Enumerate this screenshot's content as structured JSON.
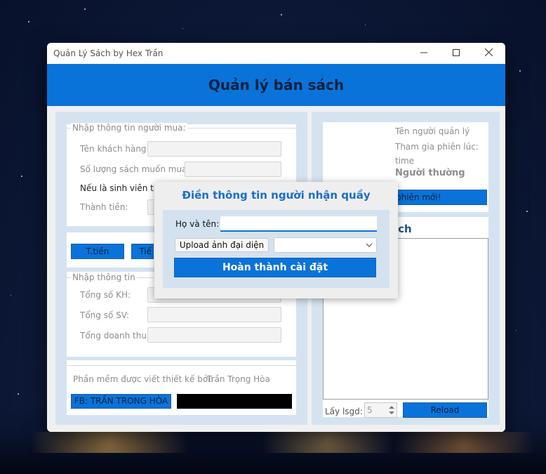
{
  "window": {
    "title": "Quản Lý Sách by Hex Trần"
  },
  "header": {
    "title": "Quản lý bán sách"
  },
  "buyer": {
    "legend": "Nhập thông tin người mua:",
    "customer_label": "Tên khách hàng:",
    "quantity_label": "Số lượng sách muốn mua:",
    "student_text": "Nếu là sinh viên thì",
    "total_label": "Thành tiền:"
  },
  "actions": {
    "calc_label": "T.tiền",
    "second_label": "Tiế"
  },
  "stats": {
    "legend": "Nhập thông tin",
    "customers_label": "Tổng số KH:",
    "students_label": "Tổng số SV:",
    "revenue_label": "Tổng doanh thu:"
  },
  "credit": {
    "text": "Phần mềm được viết  thiết kế bởi:",
    "author": "Trần Trọng Hòa",
    "fb_button": "FB: TRẦN TRONG HÒA"
  },
  "manager": {
    "name_label": "Tên người quản lý",
    "joined_label": "Tham gia phiên lúc:",
    "time": "time",
    "role": "Người thường",
    "new_session_button": "phiên mới!"
  },
  "history": {
    "title_partial": "ịch",
    "count_label": "Lấy lsgd:",
    "count_value": "5",
    "reload_button": "Reload"
  },
  "dialog": {
    "title": "Điền thông tin người nhận quầy",
    "name_label": "Họ và tên:",
    "name_value": "",
    "upload_button": "Upload ảnh đại diện",
    "finish_button": "Hoàn thành cài đặt"
  }
}
